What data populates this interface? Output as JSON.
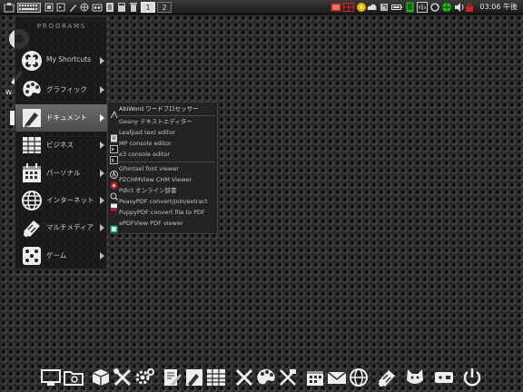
{
  "panel": {
    "workspaces": [
      "1",
      "2"
    ],
    "active_workspace": 0,
    "clock": "03:06 午後",
    "tray_icons": [
      "network-icon",
      "firewall-icon",
      "weather-icon",
      "cloud-icon",
      "keyboard-icon",
      "battery-icon",
      "update-icon",
      "network-status-icon",
      "speaker-icon",
      "volume-icon"
    ]
  },
  "menu": {
    "title": "PROGRAMS",
    "items": [
      {
        "label": "My Shortcuts",
        "icon": "shortcuts-icon"
      },
      {
        "label": "グラフィック",
        "icon": "palette-icon"
      },
      {
        "label": "ドキュメント",
        "icon": "document-icon"
      },
      {
        "label": "ビジネス",
        "icon": "spreadsheet-icon"
      },
      {
        "label": "パーソナル",
        "icon": "calendar-icon"
      },
      {
        "label": "インターネット",
        "icon": "globe-icon"
      },
      {
        "label": "マルチメディア",
        "icon": "multimedia-icon"
      },
      {
        "label": "ゲーム",
        "icon": "dice-icon"
      }
    ],
    "active_index": 2
  },
  "submenu": {
    "items": [
      {
        "label": "AbiWord ワードプロセッサー",
        "icon": "abiword-icon"
      },
      {
        "label": "Geany テキストエディター",
        "icon": "geany-icon"
      },
      {
        "label": "Leafpad text editor",
        "icon": "leafpad-icon"
      },
      {
        "label": "MP console editor",
        "icon": "console-icon"
      },
      {
        "label": "e3 console editor",
        "icon": "console-icon"
      },
      {
        "label": "Gfontsel font viewer",
        "icon": "font-icon"
      },
      {
        "label": "PZCHMView CHM Viewer",
        "icon": "chm-icon"
      },
      {
        "label": "Pdict オンライン辞書",
        "icon": "dictionary-icon"
      },
      {
        "label": "PeasyPDF convert/join/extract",
        "icon": "pdf-icon"
      },
      {
        "label": "PuppyPDF convert file to PDF",
        "icon": "pdf-convert-icon"
      },
      {
        "label": "ePDFView PDF viewer",
        "icon": "epdfview-icon"
      }
    ]
  },
  "dock": {
    "icons": [
      "monitor-icon",
      "folder-icon",
      "box-icon",
      "tools-icon",
      "settings-icon",
      "document-edit-icon",
      "document-icon",
      "spreadsheet-icon",
      "pencil-ruler-icon",
      "palette-icon",
      "scissors-icon",
      "calendar-icon",
      "mail-icon",
      "globe-icon",
      "multimedia-icon",
      "cat-icon",
      "drive-icon",
      "power-icon"
    ]
  },
  "colors": {
    "menu_bg": "#181818",
    "menu_active": "#5c5c5c",
    "pdf_red": "#b32222",
    "epdf_green": "#2fa36b",
    "tray_red": "#d22020",
    "tray_green": "#2ec52e"
  }
}
